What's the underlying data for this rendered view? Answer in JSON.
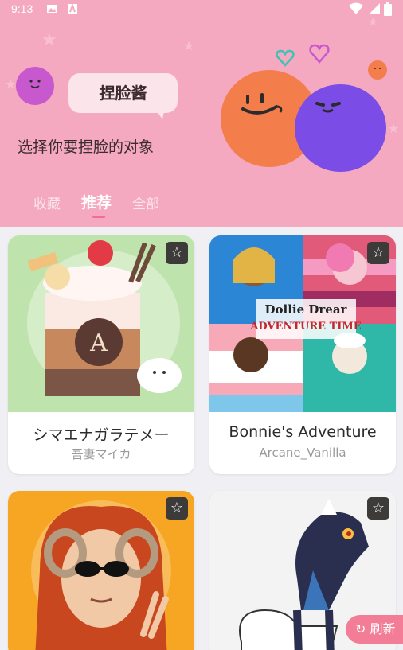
{
  "status": {
    "time": "9:13"
  },
  "header": {
    "app_name": "捏脸酱",
    "subtitle": "选择你要捏脸的对象"
  },
  "tabs": [
    {
      "label": "收藏",
      "active": false
    },
    {
      "label": "推荐",
      "active": true
    },
    {
      "label": "全部",
      "active": false
    }
  ],
  "cards": [
    {
      "title": "シマエナガラテメー",
      "author": "吾妻マイカ",
      "favorite_icon": "star-outline-icon",
      "thumbnail": "iced-drink-with-bird"
    },
    {
      "title": "Bonnie's Adventure",
      "author": "Arcane_Vanilla",
      "favorite_icon": "star-outline-icon",
      "thumbnail": "adventure-time-collage",
      "thumb_text_1": "Dollie Drear",
      "thumb_text_2": "ADVENTURE TIME"
    },
    {
      "title": "",
      "author": "",
      "favorite_icon": "star-outline-icon",
      "thumbnail": "girl-with-ram-horns"
    },
    {
      "title": "",
      "author": "",
      "favorite_icon": "star-outline-icon",
      "thumbnail": "wolf-creature"
    }
  ],
  "refresh_label": "刷新",
  "colors": {
    "header_bg": "#f4a9c1",
    "accent": "#f36d93",
    "page_bg": "#f0eff4"
  }
}
